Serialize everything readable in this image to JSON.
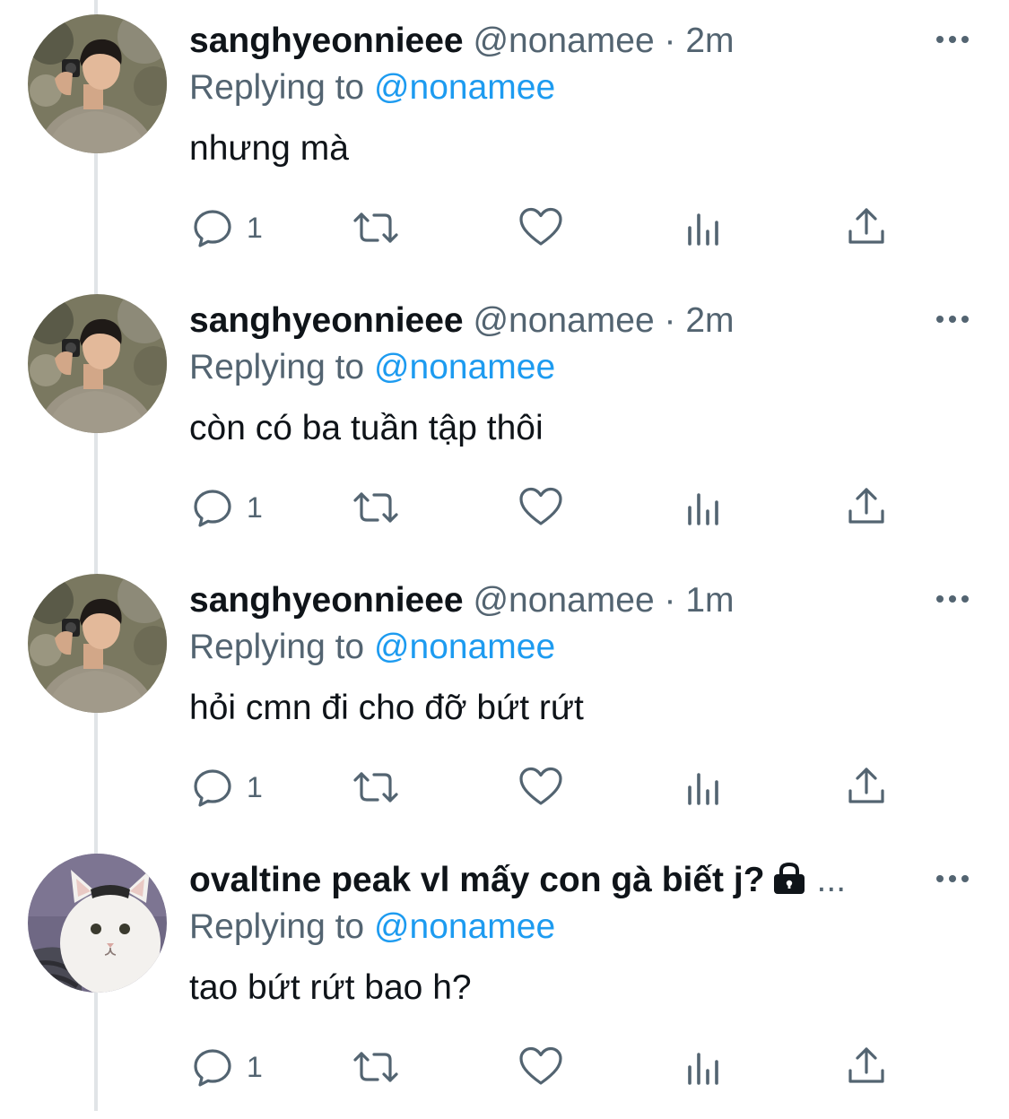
{
  "colors": {
    "text_primary": "#0f1419",
    "text_secondary": "#536471",
    "mention": "#1d9bf0",
    "thread_line": "#e1e4e7",
    "background": "#ffffff"
  },
  "tweets": [
    {
      "display_name": "sanghyeonnieee",
      "handle": "@nonamee",
      "separator": " · ",
      "time": "2m",
      "replying_prefix": "Replying to ",
      "replying_to": "@nonamee",
      "text": "nhưng mà",
      "reply_count": "1",
      "avatar": "portrait-photo",
      "protected": false
    },
    {
      "display_name": "sanghyeonnieee",
      "handle": "@nonamee",
      "separator": " · ",
      "time": "2m",
      "replying_prefix": "Replying to ",
      "replying_to": "@nonamee",
      "text": "còn có ba tuần tập thôi",
      "reply_count": "1",
      "avatar": "portrait-photo",
      "protected": false
    },
    {
      "display_name": "sanghyeonnieee",
      "handle": "@nonamee",
      "separator": " · ",
      "time": "1m",
      "replying_prefix": "Replying to ",
      "replying_to": "@nonamee",
      "text": "hỏi cmn đi cho đỡ bứt rứt",
      "reply_count": "1",
      "avatar": "portrait-photo",
      "protected": false
    },
    {
      "display_name": "ovaltine peak vl mấy con gà biết j?",
      "handle": "...",
      "replying_prefix": "Replying to ",
      "replying_to": "@nonamee",
      "text": "tao bứt rứt bao h?",
      "reply_count": "1",
      "avatar": "cat-photo",
      "protected": true
    }
  ],
  "icons": {
    "reply": "reply-icon",
    "retweet": "retweet-icon",
    "like": "heart-icon",
    "views": "views-icon",
    "share": "share-icon",
    "more": "more-icon",
    "lock": "lock-icon"
  }
}
